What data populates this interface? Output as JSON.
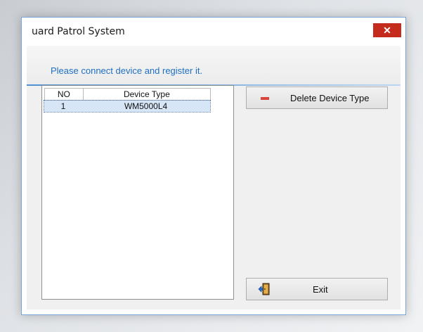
{
  "window": {
    "title": "uard Patrol System",
    "close_glyph": "✕"
  },
  "header": {
    "message": "Please connect device and register it."
  },
  "device_table": {
    "columns": [
      "NO",
      "Device Type"
    ],
    "rows": [
      {
        "no": "1",
        "device_type": "WM5000L4"
      }
    ]
  },
  "buttons": {
    "delete_label": "Delete Device Type",
    "exit_label": "Exit"
  },
  "colors": {
    "header_text": "#1e6fc4",
    "close_button": "#c42b1c",
    "selected_row": "#d7e6f7",
    "minus_icon": "#d9453a"
  }
}
